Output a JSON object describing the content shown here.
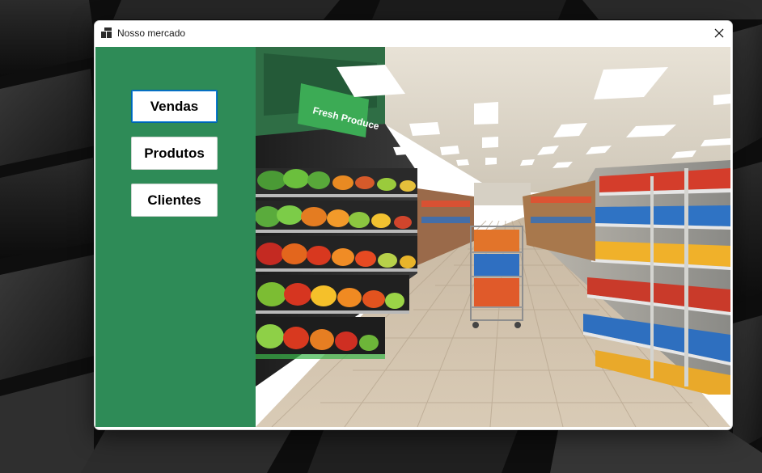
{
  "window": {
    "title": "Nosso mercado",
    "app_icon": "windows-form-icon",
    "close_icon": "close-icon"
  },
  "sidebar": {
    "background_color": "#2e8b57",
    "buttons": [
      {
        "label": "Vendas",
        "focused": true
      },
      {
        "label": "Produtos",
        "focused": false
      },
      {
        "label": "Clientes",
        "focused": false
      }
    ]
  },
  "image": {
    "sign_text": "Fresh Produce"
  }
}
